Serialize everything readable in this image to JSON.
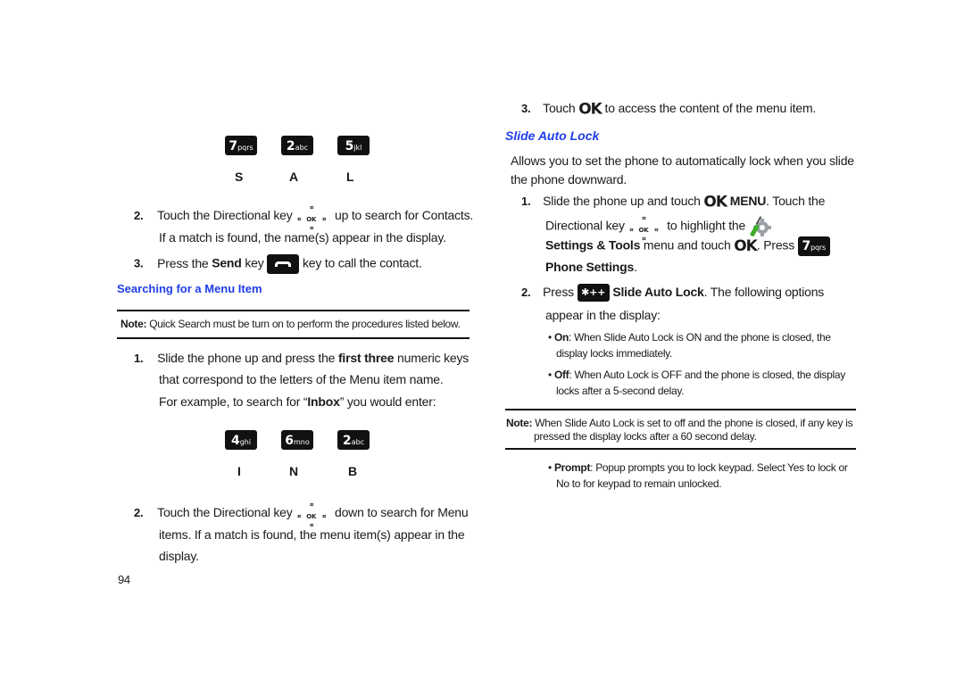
{
  "page_number": "94",
  "left": {
    "keys_row1": [
      {
        "digit": "7",
        "letters": "pqrs",
        "label": "S"
      },
      {
        "digit": "2",
        "letters": "abc",
        "label": "A"
      },
      {
        "digit": "5",
        "letters": "jkl",
        "label": "L"
      }
    ],
    "step2a": {
      "num": "2.",
      "before": "Touch the Directional key",
      "after": "up to search for Contacts.",
      "line2": "If a match is found, the name(s) appear in the display."
    },
    "step3a": {
      "num": "3.",
      "before": "Press the",
      "bold": "Send",
      "mid": "key",
      "after": "key to call the contact."
    },
    "section_heading": "Searching for a Menu Item",
    "note": {
      "label": "Note:",
      "text": "Quick Search must be turn on to perform the procedures listed below."
    },
    "step1": {
      "num": "1.",
      "before": "Slide the phone up and press the",
      "bold": "first three",
      "after": "numeric keys",
      "line2": "that correspond to the letters of the Menu item name.",
      "line3_before": "For example, to search for “",
      "line3_bold": "Inbox",
      "line3_after": "” you would enter:"
    },
    "keys_row2": [
      {
        "digit": "4",
        "letters": "ghi",
        "label": "I"
      },
      {
        "digit": "6",
        "letters": "mno",
        "label": "N"
      },
      {
        "digit": "2",
        "letters": "abc",
        "label": "B"
      }
    ],
    "step2b": {
      "num": "2.",
      "before": "Touch the Directional key",
      "after": "down to search for Menu",
      "line2": "items. If a match is found, the menu item(s) appear in the",
      "line3": "display."
    }
  },
  "right": {
    "step3": {
      "num": "3.",
      "before": "Touch",
      "ok": "OK",
      "after": "to access the content of the menu item."
    },
    "section_heading": "Slide Auto Lock",
    "intro_line1": "Allows you to set the phone to automatically lock when you slide",
    "intro_line2": "the phone downward.",
    "step1": {
      "num": "1.",
      "before": "Slide the phone up and touch",
      "ok": "OK",
      "menu": "MENU",
      "after": ". Touch the",
      "line2_before": "Directional key",
      "line2_after": "to highlight the",
      "line3_bold": "Settings & Tools",
      "line3_mid": "menu and touch",
      "line3_ok": "OK",
      "line3_after": ". Press",
      "key": {
        "digit": "7",
        "letters": "pqrs"
      },
      "line4_bold": "Phone Settings",
      "line4_after": "."
    },
    "step2": {
      "num": "2.",
      "before": "Press",
      "key": "✱++",
      "bold": "Slide Auto Lock",
      "after": ". The following options",
      "line2": "appear in the display:"
    },
    "options": [
      {
        "bold": "On",
        "text": ": When Slide Auto Lock is ON and the phone is closed, the",
        "text2": "display locks immediately."
      },
      {
        "bold": "Off",
        "text": ": When Auto Lock is OFF and the phone is closed, the display",
        "text2": "locks after a 5-second delay."
      }
    ],
    "note": {
      "label": "Note:",
      "text": "When Slide Auto Lock is set to off and the phone is closed, if any key is",
      "text2": "pressed the display locks after a 60 second delay."
    },
    "prompt_option": {
      "bold": "Prompt",
      "text": ": Popup prompts you to lock keypad. Select Yes to lock or",
      "text2": "No to for keypad to remain unlocked."
    }
  },
  "colors": {
    "heading": "#1f3ee8",
    "key_bg": "#111111",
    "text": "#1a1a1a"
  }
}
